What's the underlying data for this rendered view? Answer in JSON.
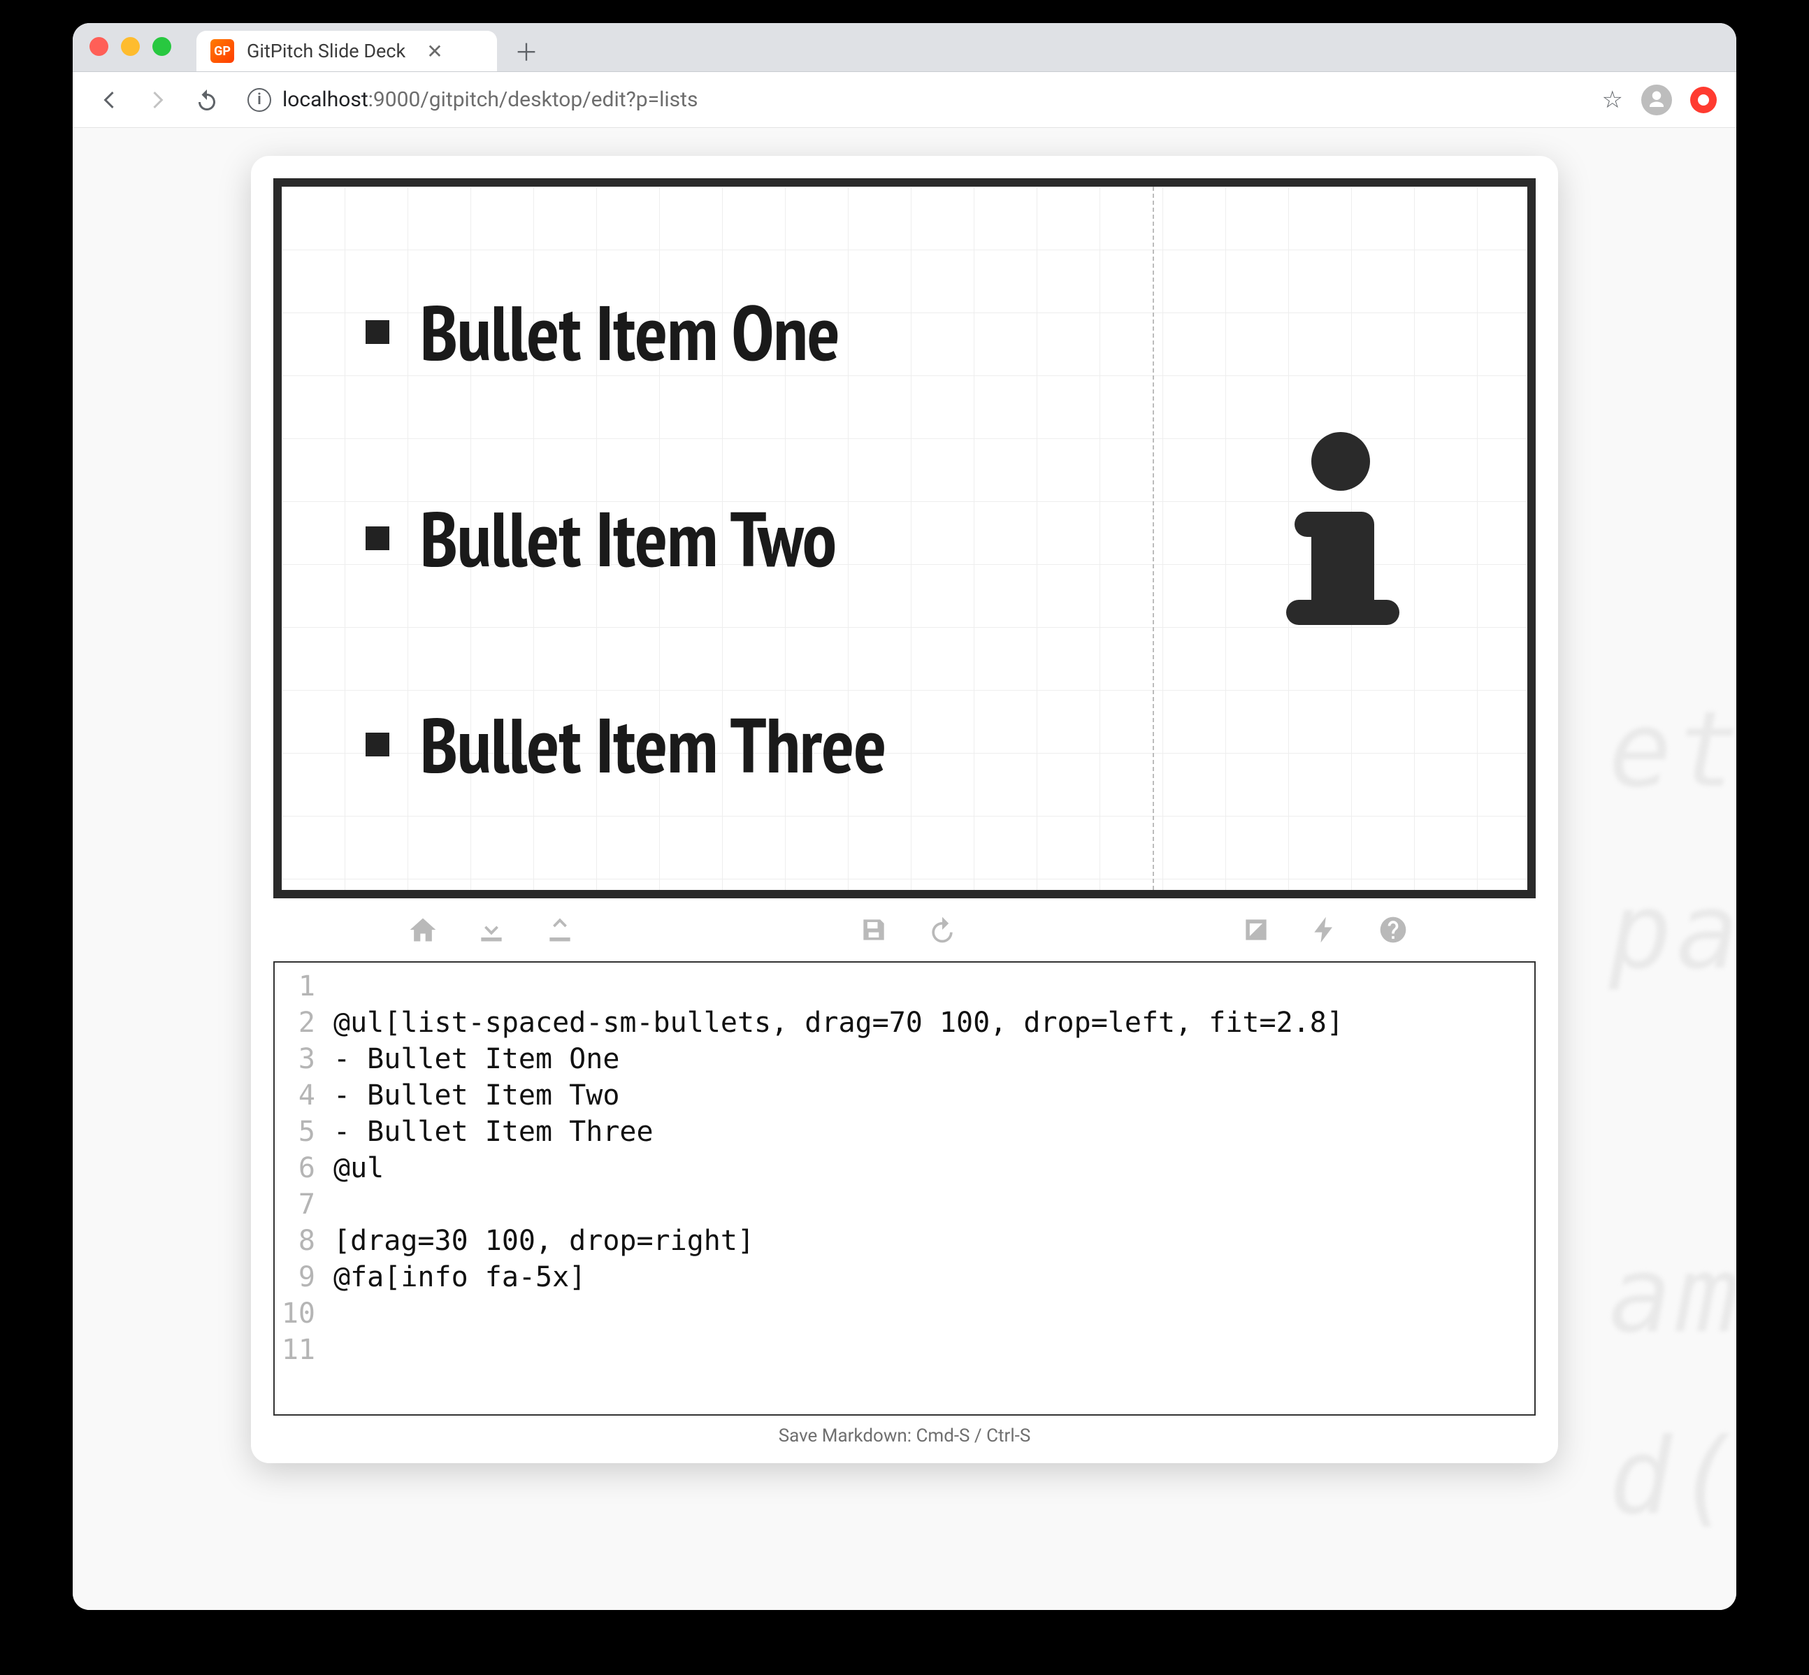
{
  "browser": {
    "tab_title": "GitPitch Slide Deck",
    "favicon_text": "GP",
    "url_host": "localhost",
    "url_port": ":9000",
    "url_path": "/gitpitch/desktop/edit?p=lists"
  },
  "slide": {
    "bullets": [
      "Bullet Item One",
      "Bullet Item Two",
      "Bullet Item Three"
    ]
  },
  "toolbar": {
    "home": "home-icon",
    "download": "download-icon",
    "upload": "upload-icon",
    "save": "save-icon",
    "refresh": "refresh-icon",
    "expand": "expand-icon",
    "bolt": "bolt-icon",
    "help": "help-icon"
  },
  "editor": {
    "lines": [
      "",
      "@ul[list-spaced-sm-bullets, drag=70 100, drop=left, fit=2.8]",
      "- Bullet Item One",
      "- Bullet Item Two",
      "- Bullet Item Three",
      "@ul",
      "",
      "[drag=30 100, drop=right]",
      "@fa[info fa-5x]",
      "",
      ""
    ]
  },
  "footer_hint": "Save Markdown: Cmd-S / Ctrl-S",
  "bg_snippets": [
    "et",
    "pa",
    "am",
    "d("
  ]
}
